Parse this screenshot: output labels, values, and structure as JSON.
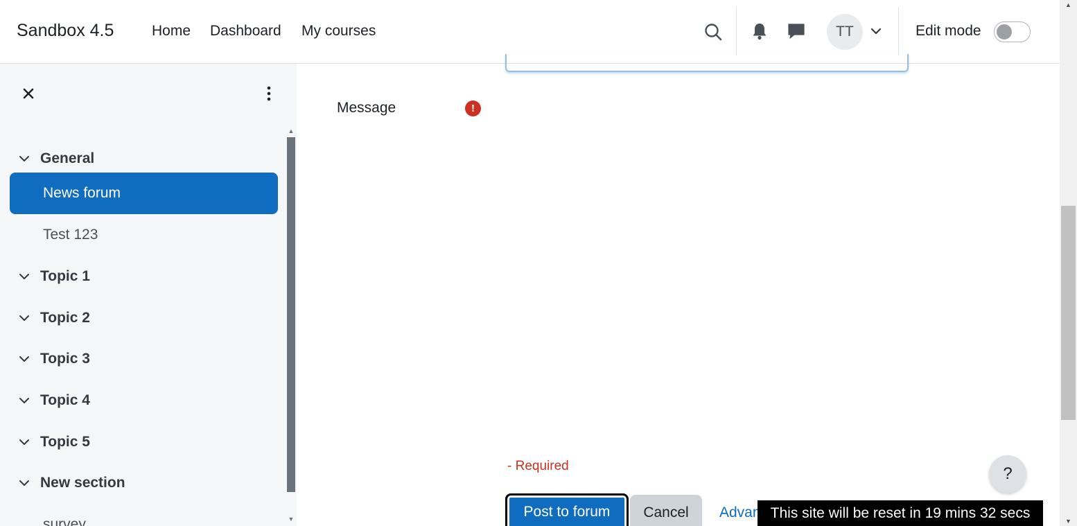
{
  "header": {
    "brand": "Sandbox 4.5",
    "nav": [
      "Home",
      "Dashboard",
      "My courses"
    ],
    "avatar_initials": "TT",
    "edit_mode_label": "Edit mode",
    "edit_mode_on": false,
    "icons": [
      "search-icon",
      "bell-icon",
      "chat-icon",
      "chevron-down-icon"
    ]
  },
  "drawer": {
    "items": [
      {
        "type": "section",
        "label": "General"
      },
      {
        "type": "activity",
        "label": "News forum",
        "active": true
      },
      {
        "type": "activity",
        "label": "Test 123",
        "active": false
      },
      {
        "type": "section",
        "label": "Topic 1"
      },
      {
        "type": "section",
        "label": "Topic 2"
      },
      {
        "type": "section",
        "label": "Topic 3"
      },
      {
        "type": "section",
        "label": "Topic 4"
      },
      {
        "type": "section",
        "label": "Topic 5"
      },
      {
        "type": "section",
        "label": "New section"
      },
      {
        "type": "activity",
        "label": "survey",
        "active": false
      }
    ]
  },
  "form": {
    "message_label": "Message",
    "required_icon": "!",
    "required_note": "- Required",
    "post_button": "Post to forum",
    "cancel_button": "Cancel",
    "advanced_link": "Advanced"
  },
  "banner": "This site will be reset in 19 mins 32 secs",
  "help_button": "?",
  "colors": {
    "primary": "#0f6cbf",
    "danger": "#ca3120",
    "drawer_bg": "#f5f6f8"
  }
}
